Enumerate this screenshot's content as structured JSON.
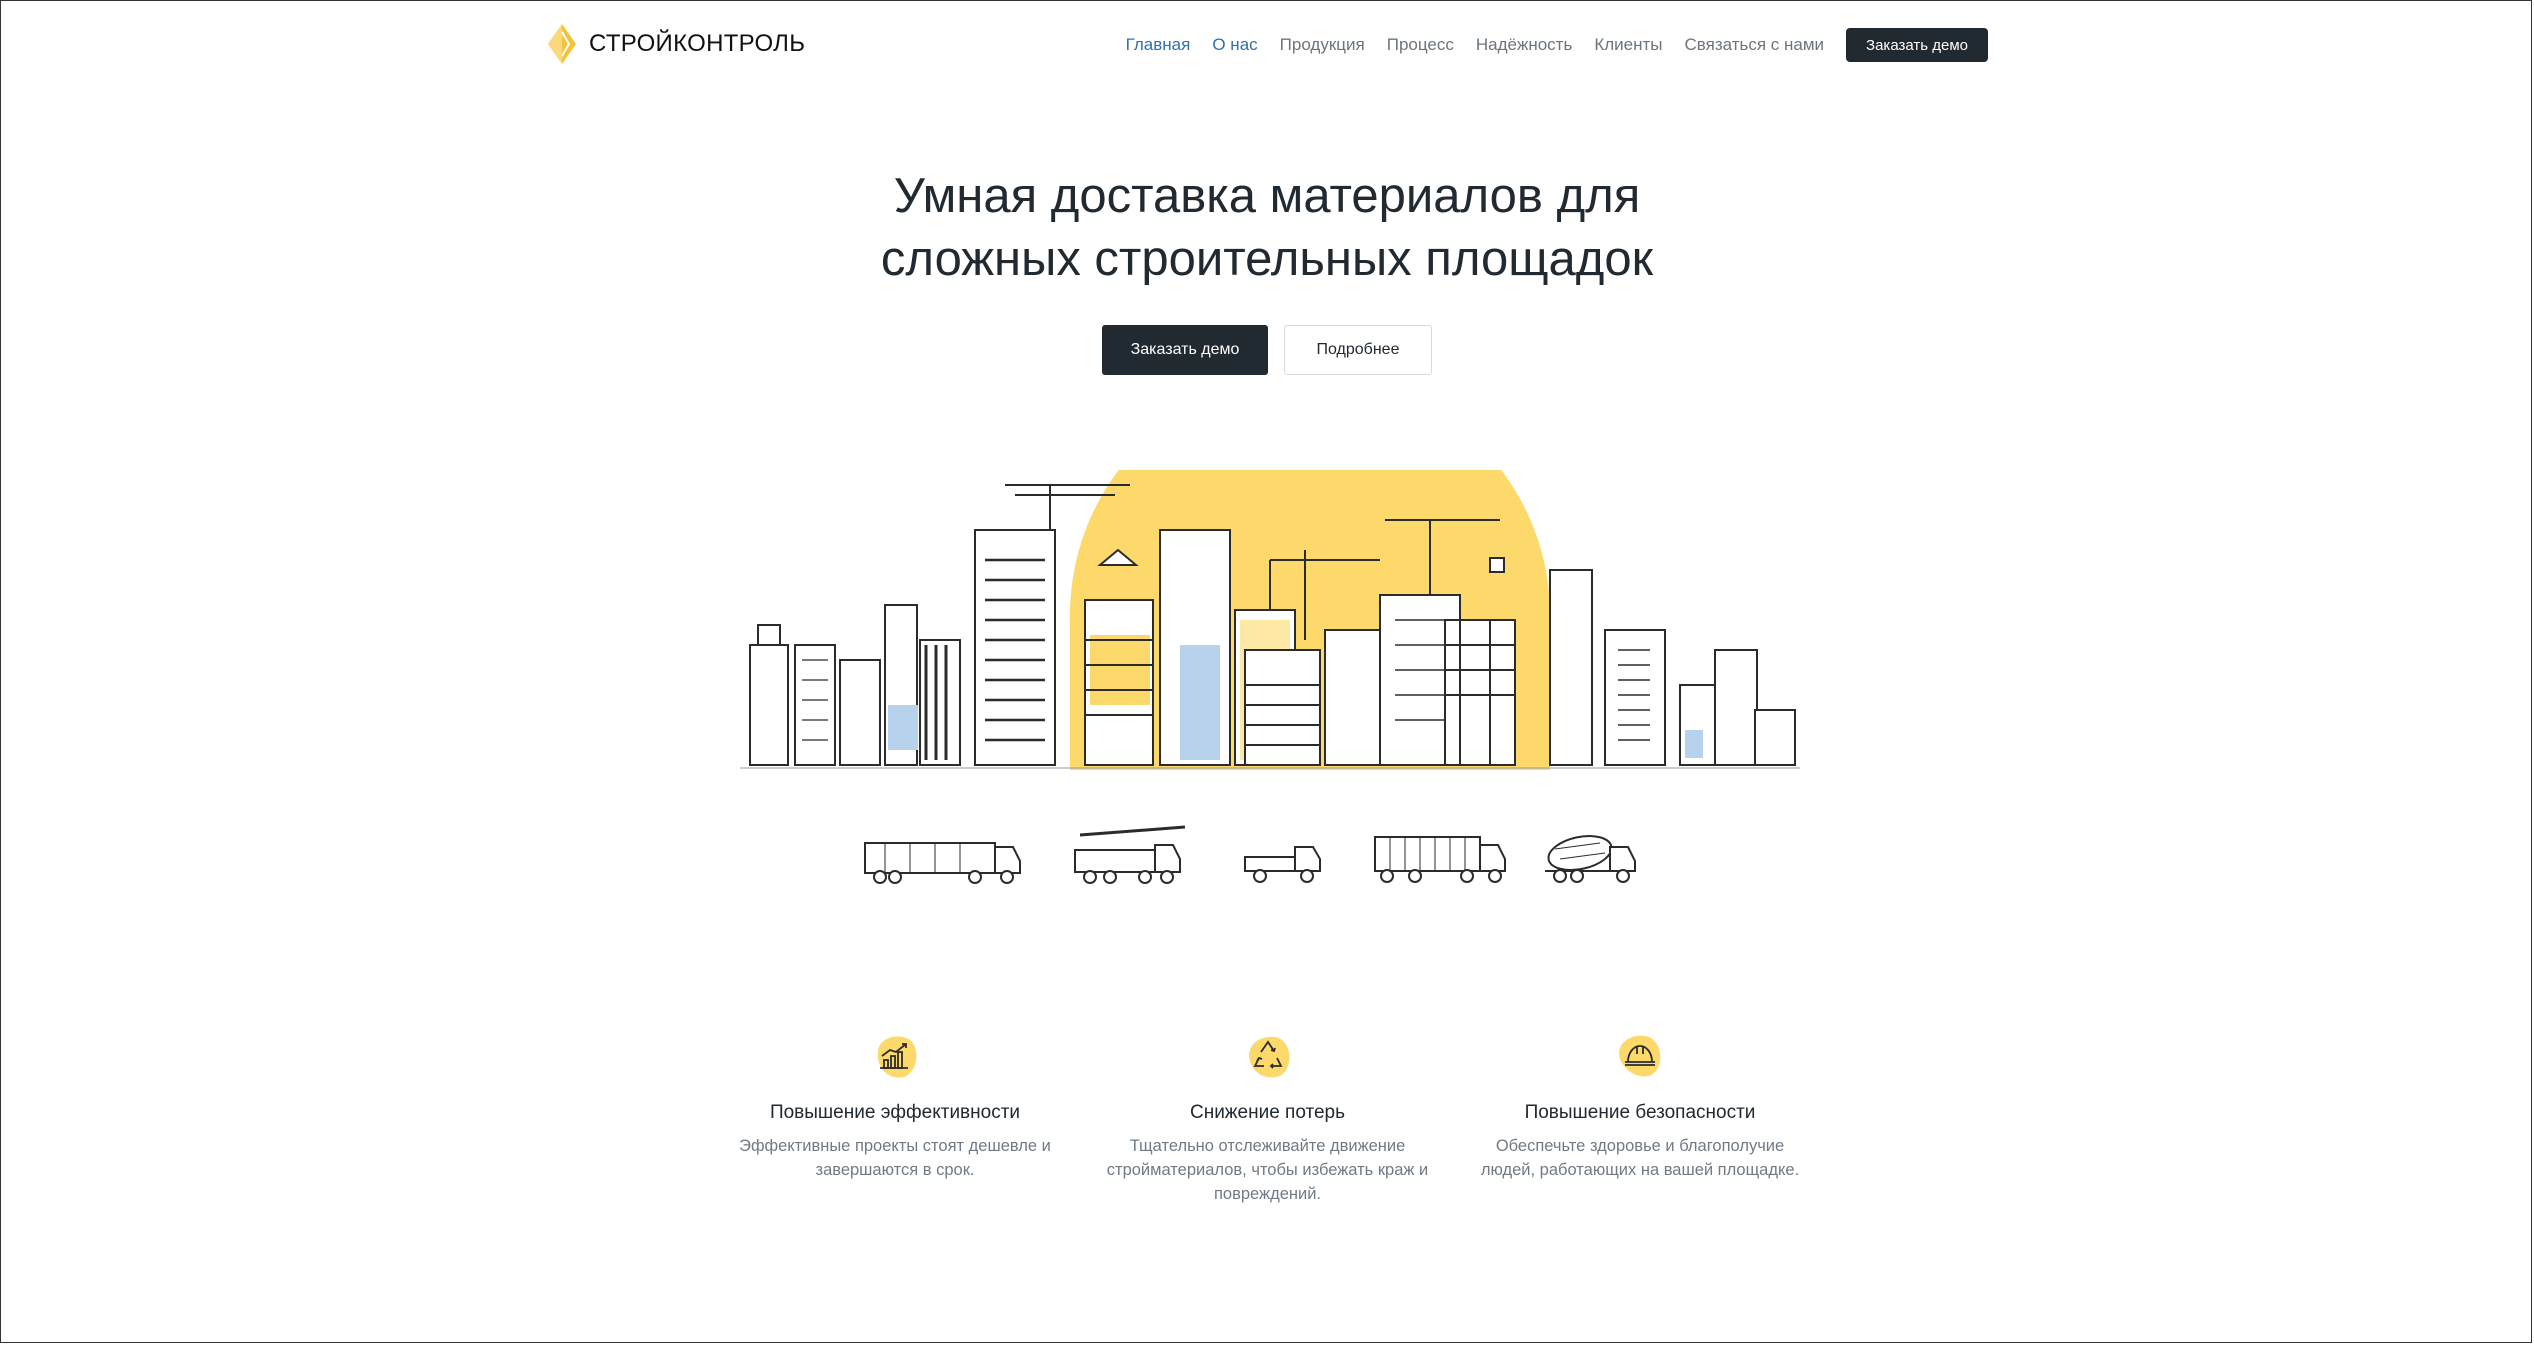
{
  "header": {
    "brand": "СТРОЙКОНТРОЛЬ",
    "nav": [
      {
        "label": "Главная",
        "active": true
      },
      {
        "label": "О нас",
        "active": true
      },
      {
        "label": "Продукция",
        "active": false
      },
      {
        "label": "Процесс",
        "active": false
      },
      {
        "label": "Надёжность",
        "active": false
      },
      {
        "label": "Клиенты",
        "active": false
      },
      {
        "label": "Связаться с нами",
        "active": false
      }
    ],
    "cta": "Заказать демо"
  },
  "hero": {
    "title_line1": "Умная доставка материалов для",
    "title_line2": "сложных строительных площадок",
    "primary_button": "Заказать демо",
    "secondary_button": "Подробнее"
  },
  "illustrations": {
    "city": "city-skyline-illustration",
    "trucks": [
      "flatbed-trailer-truck",
      "crane-truck",
      "small-flatbed-truck",
      "container-truck",
      "concrete-mixer-truck"
    ]
  },
  "features": [
    {
      "icon": "chart-growth-icon",
      "title": "Повышение эффективности",
      "text": "Эффективные проекты стоят дешевле и завершаются в срок."
    },
    {
      "icon": "recycle-icon",
      "title": "Снижение потерь",
      "text": "Тщательно отслеживайте движение стройматериалов, чтобы избежать краж и повреждений."
    },
    {
      "icon": "hard-hat-icon",
      "title": "Повышение безопасности",
      "text": "Обеспечьте здоровье и благополучие людей, работающих на вашей площадке."
    }
  ],
  "colors": {
    "accent_yellow": "#fcd96a",
    "dark": "#212931",
    "link_blue": "#2f6fb2",
    "window_blue": "#b8d2ee"
  }
}
